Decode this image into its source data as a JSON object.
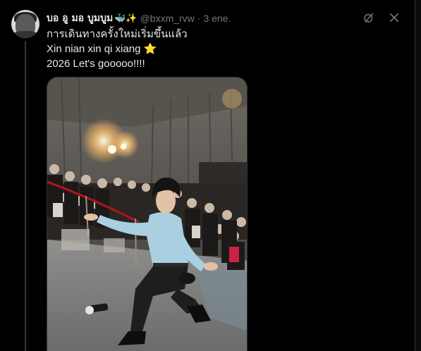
{
  "tweet": {
    "display_name": "บอ อู มอ บูมบูม",
    "name_emojis": "🐳✨",
    "handle": "@bxxm_rvw",
    "separator": "·",
    "date": "3 ene.",
    "text_lines": [
      "การเดินทางครั้งใหม่เริ่มขึ้นแล้ว",
      "Xin nian xin qi xiang",
      "2026 Let's gooooo!!!!"
    ],
    "star_emoji": "⭐"
  },
  "icons": {
    "grok": "grok-icon",
    "more": "more-options-icon"
  },
  "colors": {
    "background": "#000000",
    "text": "#e7e9ea",
    "muted": "#71767b",
    "divider": "#2f3336",
    "shirt": "#a9cfe0"
  }
}
